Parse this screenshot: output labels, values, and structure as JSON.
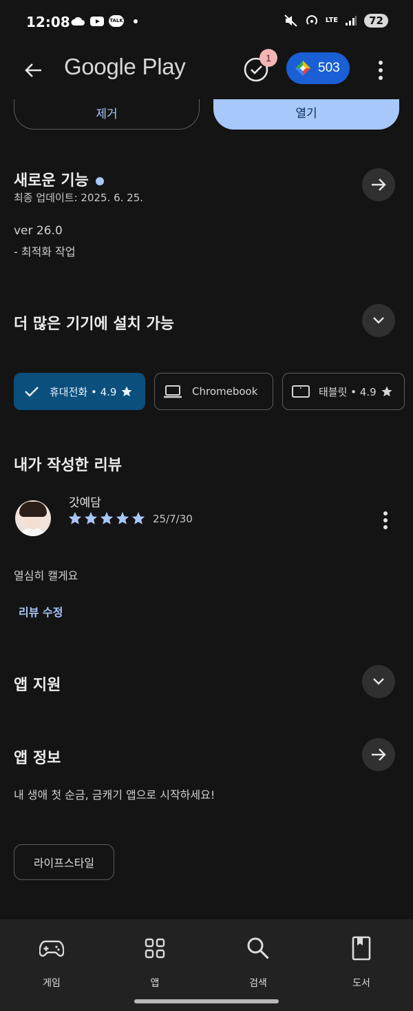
{
  "status_bar": {
    "time": "12:08",
    "battery": "72",
    "lte": "LTE",
    "talk": "TALK"
  },
  "app_bar": {
    "title": "Google Play",
    "badge_count": "1",
    "points": "503"
  },
  "actions": {
    "uninstall": "제거",
    "open": "열기"
  },
  "whats_new": {
    "title": "새로운 기능",
    "updated": "최종 업데이트: 2025. 6. 25.",
    "version": "ver 26.0",
    "note": "- 최적화 작업"
  },
  "devices": {
    "title": "더 많은 기기에 설치 가능",
    "chips": [
      {
        "label": "휴대전화 • 4.9",
        "icon": "check-icon",
        "selected": true
      },
      {
        "label": "Chromebook",
        "icon": "laptop-icon",
        "selected": false
      },
      {
        "label": "태블릿 • 4.9",
        "icon": "tablet-icon",
        "selected": false
      }
    ]
  },
  "my_review": {
    "title": "내가 작성한 리뷰",
    "reviewer": "갓예담",
    "rating": 5,
    "date": "25/7/30",
    "text": "열심히 캘게요",
    "edit": "리뷰 수정"
  },
  "app_support": {
    "title": "앱 지원"
  },
  "app_info": {
    "title": "앱 정보",
    "description": "내 생애 첫 순금, 금캐기 앱으로 시작하세요!",
    "tag": "라이프스타일"
  },
  "nav": {
    "items": [
      {
        "label": "게임",
        "icon": "gamepad-icon"
      },
      {
        "label": "앱",
        "icon": "apps-grid-icon"
      },
      {
        "label": "검색",
        "icon": "search-icon"
      },
      {
        "label": "도서",
        "icon": "book-icon"
      }
    ]
  },
  "colors": {
    "background": "#141414",
    "accent": "#a8c7fa",
    "points_pill": "#1a5fd6",
    "selected_chip": "#0b4f7c"
  }
}
